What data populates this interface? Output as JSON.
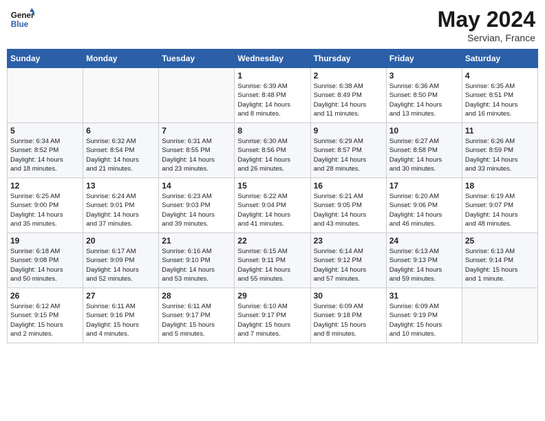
{
  "header": {
    "logo_line1": "General",
    "logo_line2": "Blue",
    "month_year": "May 2024",
    "location": "Servian, France"
  },
  "days_of_week": [
    "Sunday",
    "Monday",
    "Tuesday",
    "Wednesday",
    "Thursday",
    "Friday",
    "Saturday"
  ],
  "weeks": [
    [
      {
        "day": "",
        "content": ""
      },
      {
        "day": "",
        "content": ""
      },
      {
        "day": "",
        "content": ""
      },
      {
        "day": "1",
        "content": "Sunrise: 6:39 AM\nSunset: 8:48 PM\nDaylight: 14 hours\nand 8 minutes."
      },
      {
        "day": "2",
        "content": "Sunrise: 6:38 AM\nSunset: 8:49 PM\nDaylight: 14 hours\nand 11 minutes."
      },
      {
        "day": "3",
        "content": "Sunrise: 6:36 AM\nSunset: 8:50 PM\nDaylight: 14 hours\nand 13 minutes."
      },
      {
        "day": "4",
        "content": "Sunrise: 6:35 AM\nSunset: 8:51 PM\nDaylight: 14 hours\nand 16 minutes."
      }
    ],
    [
      {
        "day": "5",
        "content": "Sunrise: 6:34 AM\nSunset: 8:52 PM\nDaylight: 14 hours\nand 18 minutes."
      },
      {
        "day": "6",
        "content": "Sunrise: 6:32 AM\nSunset: 8:54 PM\nDaylight: 14 hours\nand 21 minutes."
      },
      {
        "day": "7",
        "content": "Sunrise: 6:31 AM\nSunset: 8:55 PM\nDaylight: 14 hours\nand 23 minutes."
      },
      {
        "day": "8",
        "content": "Sunrise: 6:30 AM\nSunset: 8:56 PM\nDaylight: 14 hours\nand 26 minutes."
      },
      {
        "day": "9",
        "content": "Sunrise: 6:29 AM\nSunset: 8:57 PM\nDaylight: 14 hours\nand 28 minutes."
      },
      {
        "day": "10",
        "content": "Sunrise: 6:27 AM\nSunset: 8:58 PM\nDaylight: 14 hours\nand 30 minutes."
      },
      {
        "day": "11",
        "content": "Sunrise: 6:26 AM\nSunset: 8:59 PM\nDaylight: 14 hours\nand 33 minutes."
      }
    ],
    [
      {
        "day": "12",
        "content": "Sunrise: 6:25 AM\nSunset: 9:00 PM\nDaylight: 14 hours\nand 35 minutes."
      },
      {
        "day": "13",
        "content": "Sunrise: 6:24 AM\nSunset: 9:01 PM\nDaylight: 14 hours\nand 37 minutes."
      },
      {
        "day": "14",
        "content": "Sunrise: 6:23 AM\nSunset: 9:03 PM\nDaylight: 14 hours\nand 39 minutes."
      },
      {
        "day": "15",
        "content": "Sunrise: 6:22 AM\nSunset: 9:04 PM\nDaylight: 14 hours\nand 41 minutes."
      },
      {
        "day": "16",
        "content": "Sunrise: 6:21 AM\nSunset: 9:05 PM\nDaylight: 14 hours\nand 43 minutes."
      },
      {
        "day": "17",
        "content": "Sunrise: 6:20 AM\nSunset: 9:06 PM\nDaylight: 14 hours\nand 46 minutes."
      },
      {
        "day": "18",
        "content": "Sunrise: 6:19 AM\nSunset: 9:07 PM\nDaylight: 14 hours\nand 48 minutes."
      }
    ],
    [
      {
        "day": "19",
        "content": "Sunrise: 6:18 AM\nSunset: 9:08 PM\nDaylight: 14 hours\nand 50 minutes."
      },
      {
        "day": "20",
        "content": "Sunrise: 6:17 AM\nSunset: 9:09 PM\nDaylight: 14 hours\nand 52 minutes."
      },
      {
        "day": "21",
        "content": "Sunrise: 6:16 AM\nSunset: 9:10 PM\nDaylight: 14 hours\nand 53 minutes."
      },
      {
        "day": "22",
        "content": "Sunrise: 6:15 AM\nSunset: 9:11 PM\nDaylight: 14 hours\nand 55 minutes."
      },
      {
        "day": "23",
        "content": "Sunrise: 6:14 AM\nSunset: 9:12 PM\nDaylight: 14 hours\nand 57 minutes."
      },
      {
        "day": "24",
        "content": "Sunrise: 6:13 AM\nSunset: 9:13 PM\nDaylight: 14 hours\nand 59 minutes."
      },
      {
        "day": "25",
        "content": "Sunrise: 6:13 AM\nSunset: 9:14 PM\nDaylight: 15 hours\nand 1 minute."
      }
    ],
    [
      {
        "day": "26",
        "content": "Sunrise: 6:12 AM\nSunset: 9:15 PM\nDaylight: 15 hours\nand 2 minutes."
      },
      {
        "day": "27",
        "content": "Sunrise: 6:11 AM\nSunset: 9:16 PM\nDaylight: 15 hours\nand 4 minutes."
      },
      {
        "day": "28",
        "content": "Sunrise: 6:11 AM\nSunset: 9:17 PM\nDaylight: 15 hours\nand 5 minutes."
      },
      {
        "day": "29",
        "content": "Sunrise: 6:10 AM\nSunset: 9:17 PM\nDaylight: 15 hours\nand 7 minutes."
      },
      {
        "day": "30",
        "content": "Sunrise: 6:09 AM\nSunset: 9:18 PM\nDaylight: 15 hours\nand 8 minutes."
      },
      {
        "day": "31",
        "content": "Sunrise: 6:09 AM\nSunset: 9:19 PM\nDaylight: 15 hours\nand 10 minutes."
      },
      {
        "day": "",
        "content": ""
      }
    ]
  ]
}
